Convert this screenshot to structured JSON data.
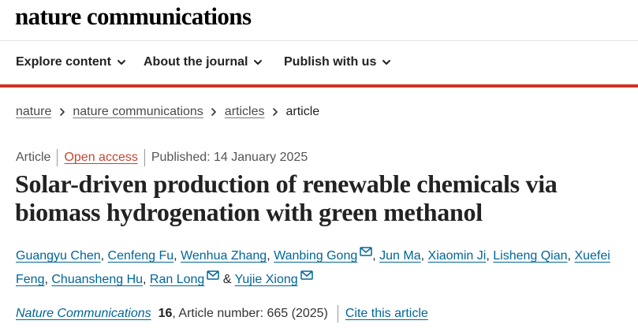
{
  "site": {
    "brand": "nature communications"
  },
  "nav": {
    "items": [
      {
        "label": "Explore content"
      },
      {
        "label": "About the journal"
      },
      {
        "label": "Publish with us"
      }
    ],
    "accent_color": "#cc3327"
  },
  "breadcrumb": {
    "items": [
      "nature",
      "nature communications",
      "articles"
    ],
    "current": "article"
  },
  "article": {
    "type": "Article",
    "access": "Open access",
    "published": "Published: 14 January 2025",
    "title": "Solar-driven production of renewable chemicals via biomass hydrogenation with green methanol",
    "authors": [
      "Guangyu Chen",
      "Cenfeng Fu",
      "Wenhua Zhang",
      "Wanbing Gong",
      "Jun Ma",
      "Xiaomin Ji",
      "Lisheng Qian",
      "Xuefei Feng",
      "Chuansheng Hu",
      "Ran Long",
      "Yujie Xiong"
    ],
    "author_separator": ",",
    "author_conjunction": "&",
    "corresponding_icon": "envelope-icon",
    "journal": "Nature Communications",
    "volume": "16",
    "article_number": ", Article number: 665 (2025)",
    "cite_label": "Cite this article",
    "link_color": "#006699"
  }
}
